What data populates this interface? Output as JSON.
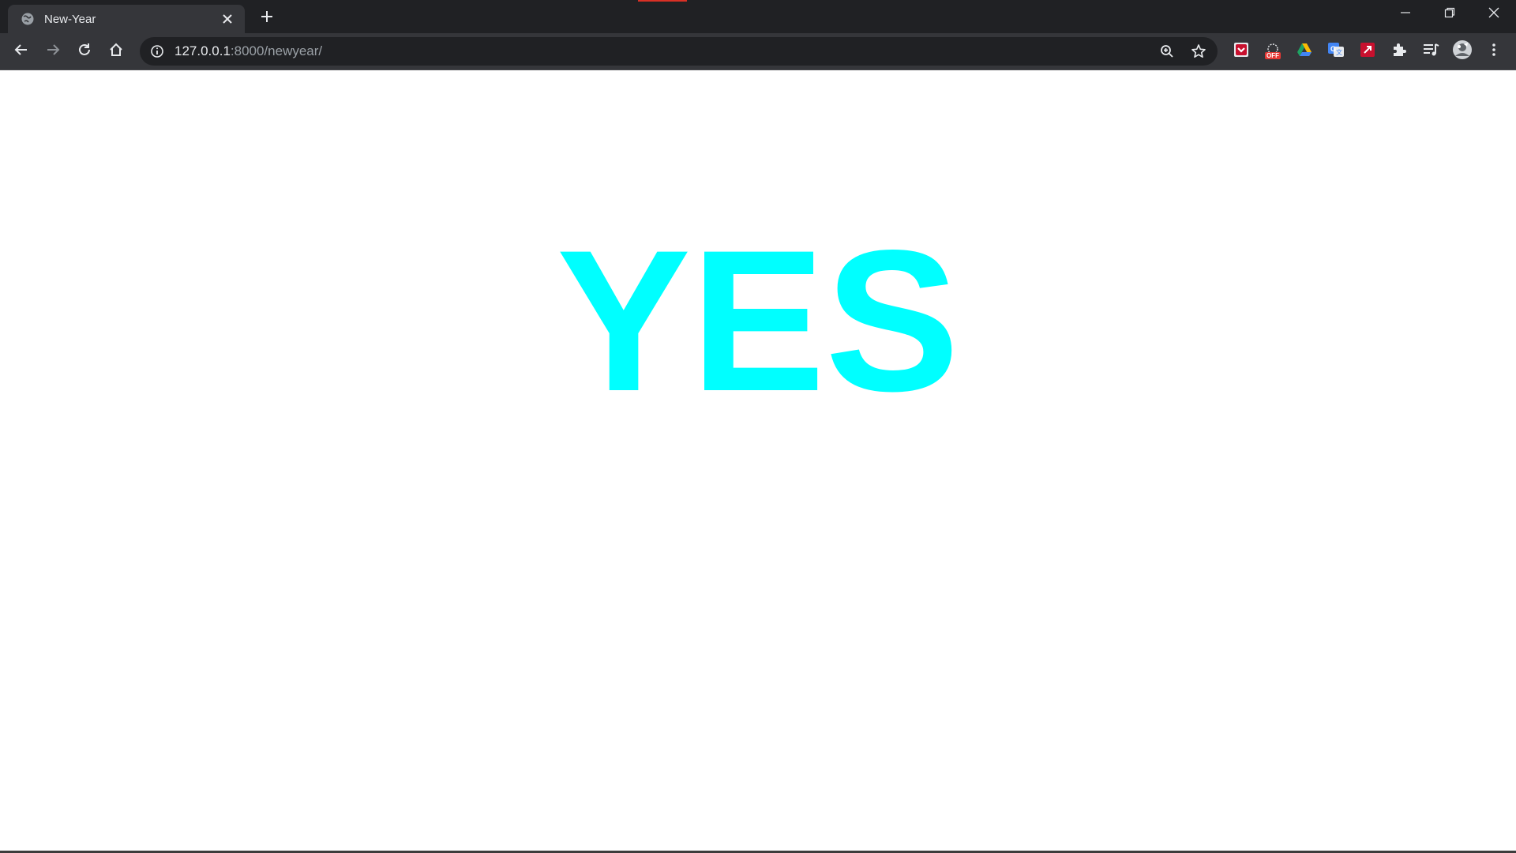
{
  "browser": {
    "tab": {
      "title": "New-Year",
      "favicon": "globe-icon"
    },
    "new_tab_icon": "plus-icon",
    "window_controls": [
      "minimize-icon",
      "restore-icon",
      "close-icon"
    ],
    "toolbar": {
      "back_icon": "arrow-left-icon",
      "forward_icon": "arrow-right-icon",
      "reload_icon": "reload-icon",
      "home_icon": "home-icon"
    },
    "omnibox": {
      "url_host": "127.0.0.1",
      "url_rest": ":8000/newyear/",
      "info_icon": "info-icon",
      "zoom_icon": "zoom-icon",
      "bookmark_icon": "star-icon"
    },
    "extensions": [
      "pocket-icon",
      "coupon-off-icon",
      "drive-icon",
      "translate-icon",
      "pdf-icon",
      "puzzle-icon",
      "media-queue-icon",
      "profile-avatar",
      "kebab-menu-icon"
    ],
    "coupon_badge": "OFF"
  },
  "page": {
    "headline": "YES",
    "headline_color": "#00ffff"
  },
  "colors": {
    "tabstrip": "#202124",
    "toolbar": "#35363a",
    "omnibox": "#202124",
    "accent_cyan": "#00ffff"
  }
}
